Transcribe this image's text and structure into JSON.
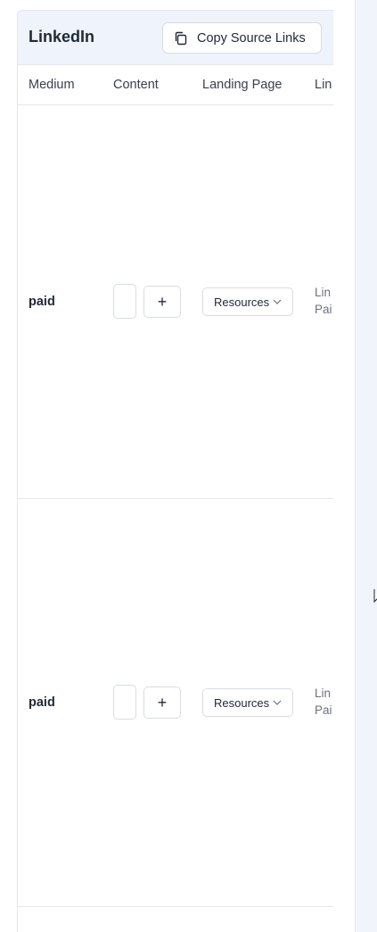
{
  "card": {
    "title": "LinkedIn",
    "copy_button_label": "Copy Source Links",
    "copy_icon": "copy-icon"
  },
  "table": {
    "columns": [
      "Medium",
      "Content",
      "Landing Page",
      "Lin"
    ],
    "rows": [
      {
        "medium": "paid",
        "content_add_label": "+",
        "landing_page": "Resources",
        "link_line1": "Lin",
        "link_line2": "Pai"
      },
      {
        "medium": "paid",
        "content_add_label": "+",
        "landing_page": "Resources",
        "link_line1": "Lin",
        "link_line2": "Pai"
      }
    ]
  },
  "colors": {
    "header_bg": "#eef3fc",
    "right_pane_bg": "#f1f4fb",
    "border": "#e3e6ec"
  }
}
